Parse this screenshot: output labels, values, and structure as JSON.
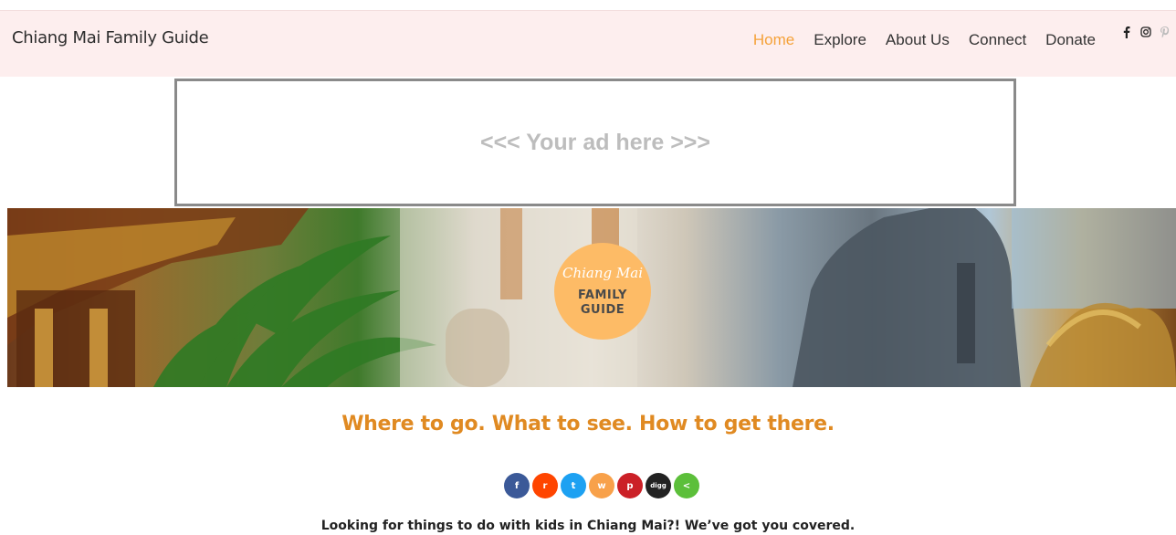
{
  "header": {
    "brand": "Chiang Mai Family Guide",
    "nav": [
      "Home",
      "Explore",
      "About Us",
      "Connect",
      "Donate"
    ],
    "active_nav": "Home",
    "social_icons": [
      "facebook-icon",
      "instagram-icon",
      "pinterest-icon"
    ]
  },
  "ad": {
    "text": "<<< Your ad here >>>"
  },
  "hero": {
    "badge_script": "Chiang Mai",
    "badge_line1": "FAMILY",
    "badge_line2": "GUIDE"
  },
  "tagline": "Where to go. What to see. How to get there.",
  "share_buttons": [
    {
      "name": "facebook-share-icon",
      "glyph": "f",
      "color": "#3b5998"
    },
    {
      "name": "reddit-share-icon",
      "glyph": "r",
      "color": "#ff4500"
    },
    {
      "name": "twitter-share-icon",
      "glyph": "t",
      "color": "#1da1f2"
    },
    {
      "name": "weibo-share-icon",
      "glyph": "w",
      "color": "#f8a14a"
    },
    {
      "name": "pinterest-share-icon",
      "glyph": "p",
      "color": "#cb2027"
    },
    {
      "name": "digg-share-icon",
      "glyph": "digg",
      "color": "#222222"
    },
    {
      "name": "share-icon",
      "glyph": "<",
      "color": "#5cbf3a"
    }
  ],
  "intro": "Looking for things to do with kids in Chiang Mai?! We’ve got you covered.",
  "colors": {
    "accent": "#f5a23a",
    "navbar_bg": "#fdeeee",
    "badge": "#fdbb66",
    "tagline": "#e08a22"
  }
}
